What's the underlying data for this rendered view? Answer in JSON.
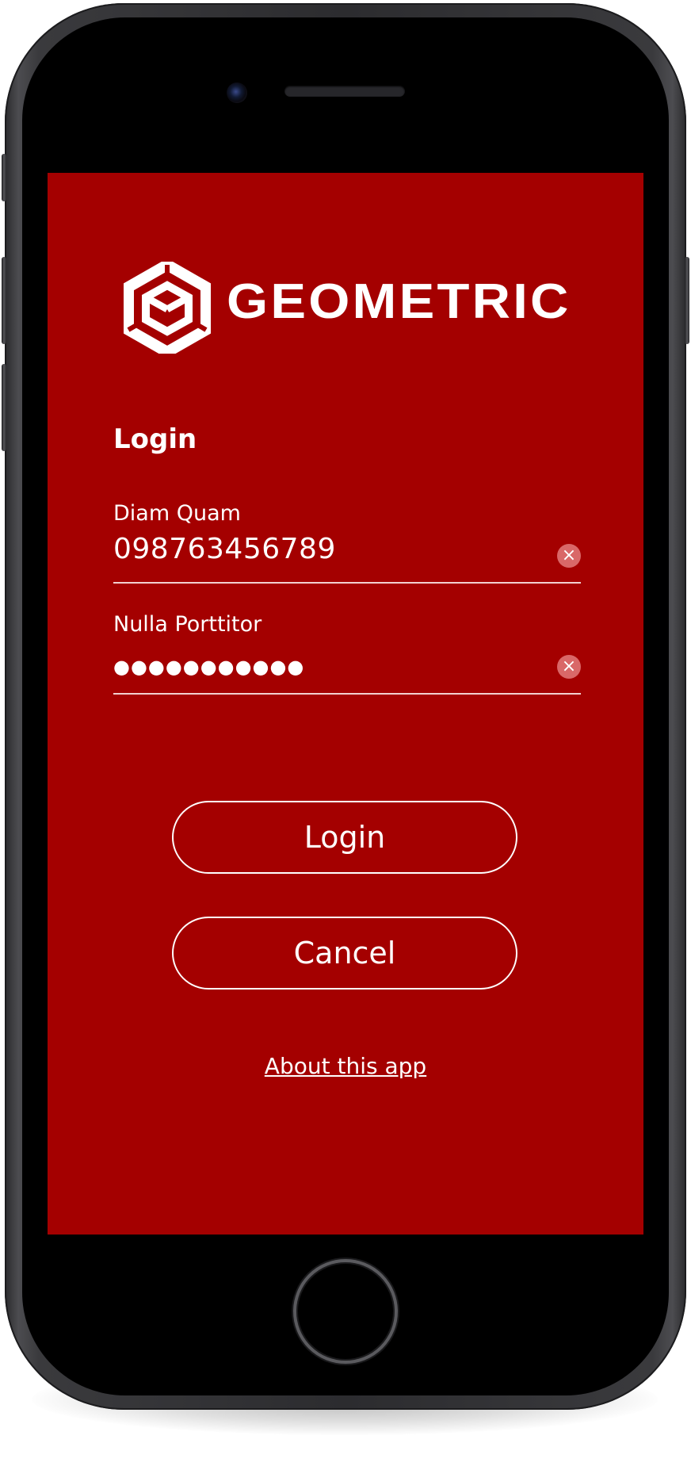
{
  "brand": {
    "name": "GEOMETRIC",
    "logo_icon": "hexagon-cube-icon"
  },
  "form": {
    "heading": "Login",
    "username": {
      "label": "Diam Quam",
      "value": "098763456789",
      "clear_icon": "clear-icon",
      "clear_glyph": "×"
    },
    "password": {
      "label": "Nulla Porttitor",
      "value": "●●●●●●●●●●●",
      "clear_icon": "clear-icon",
      "clear_glyph": "×"
    }
  },
  "actions": {
    "login": "Login",
    "cancel": "Cancel",
    "about": "About this app"
  },
  "colors": {
    "screen_background": "#a40000",
    "text": "#ffffff",
    "clear_button": "#d96868"
  }
}
